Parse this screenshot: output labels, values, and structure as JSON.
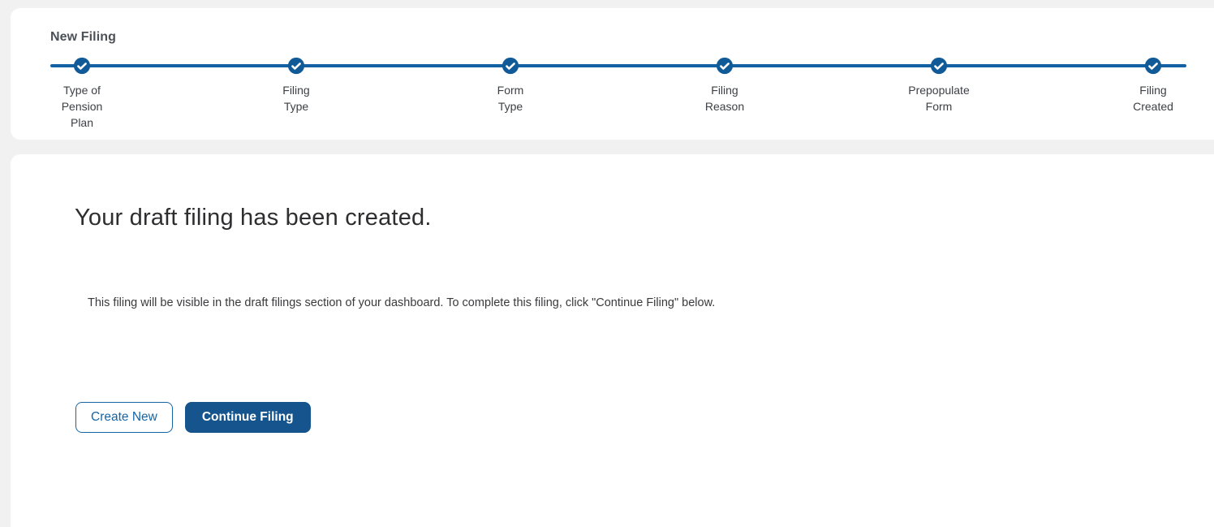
{
  "page": {
    "title": "New Filing"
  },
  "stepper": {
    "steps": [
      {
        "label": "Type of\nPension\nPlan",
        "state": "completed"
      },
      {
        "label": "Filing\nType",
        "state": "completed"
      },
      {
        "label": "Form\nType",
        "state": "completed"
      },
      {
        "label": "Filing\nReason",
        "state": "completed"
      },
      {
        "label": "Prepopulate\nForm",
        "state": "completed"
      },
      {
        "label": "Filing\nCreated",
        "state": "completed"
      }
    ]
  },
  "main": {
    "heading": "Your draft filing has been created.",
    "description": "This filing will be visible in the draft filings section of your dashboard. To complete this filing, click \"Continue Filing\" below.",
    "buttons": {
      "create_new": "Create New",
      "continue_filing": "Continue Filing"
    }
  },
  "colors": {
    "primary_blue": "#1262a4",
    "step_circle_blue": "#115a98",
    "button_fill_blue": "#15548c",
    "outline_button_blue": "#1565a5",
    "background_gray": "#f1f1f2",
    "card_white": "#ffffff",
    "title_gray": "#4c5157",
    "heading_text": "#2e2e30",
    "body_text": "#3a3a3c"
  }
}
